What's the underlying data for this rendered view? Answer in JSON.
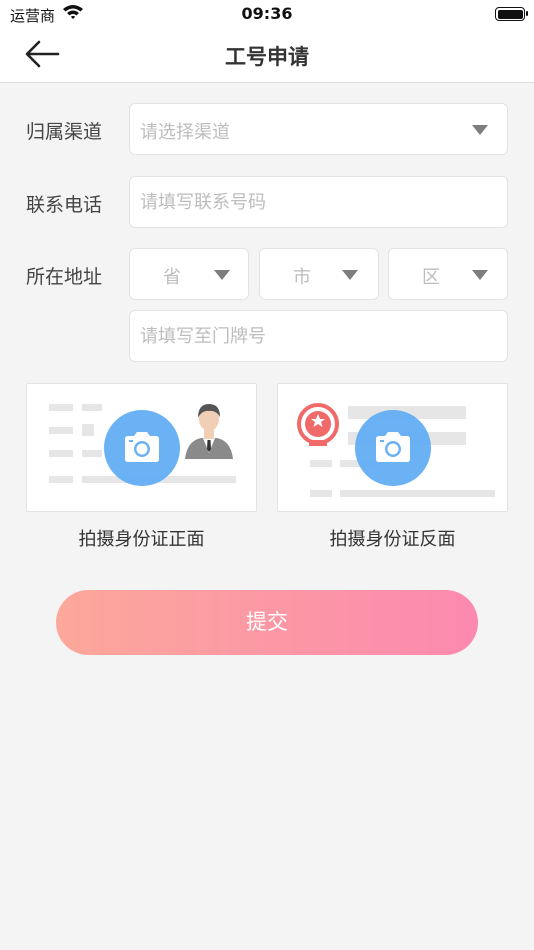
{
  "status_bar": {
    "carrier": "运营商",
    "time": "09:36"
  },
  "nav": {
    "title": "工号申请"
  },
  "form": {
    "channel": {
      "label": "归属渠道",
      "placeholder": "请选择渠道"
    },
    "phone": {
      "label": "联系电话",
      "placeholder": "请填写联系号码"
    },
    "address": {
      "label": "所在地址",
      "province": "省",
      "city": "市",
      "district": "区",
      "detail_placeholder": "请填写至门牌号"
    }
  },
  "id_photos": {
    "front_label": "拍摄身份证正面",
    "back_label": "拍摄身份证反面"
  },
  "submit_label": "提交",
  "colors": {
    "camera_blue": "#64aef5",
    "emblem_red": "#f06a6a",
    "submit_start": "#fca89a",
    "submit_end": "#fc89b0"
  }
}
